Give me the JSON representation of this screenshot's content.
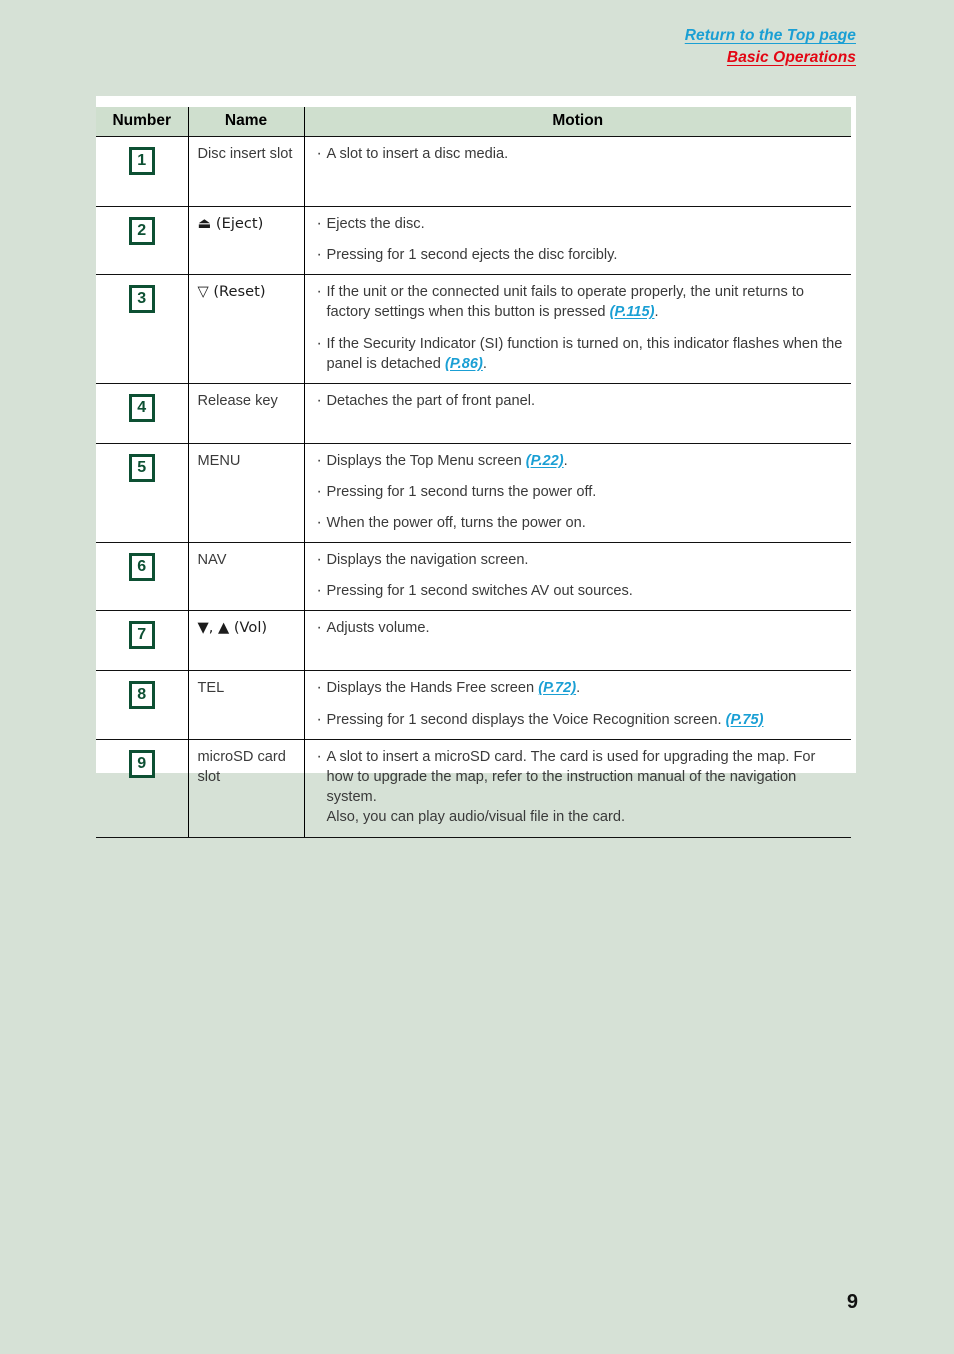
{
  "header": {
    "top_link": "Return to the Top page",
    "section_link": "Basic Operations",
    "top_link_color": "#1a9fd4",
    "section_link_color": "#e30613"
  },
  "table": {
    "columns": [
      "Number",
      "Name",
      "Motion"
    ],
    "rows": [
      {
        "number": "1",
        "name": "Disc insert slot",
        "motion": [
          {
            "text": "A slot to insert a disc media."
          }
        ]
      },
      {
        "number": "2",
        "name": "⏏ (Eject)",
        "name_symbol": "eject-icon",
        "motion": [
          {
            "text": "Ejects the disc."
          },
          {
            "text": "Pressing for 1 second ejects the disc forcibly."
          }
        ]
      },
      {
        "number": "3",
        "name": "▽ (Reset)",
        "name_symbol": "reset-triangle-icon",
        "motion": [
          {
            "text": "If the unit or the connected unit fails to operate properly, the unit returns to factory settings when this button is pressed ",
            "ref": "(P.115)",
            "tail": "."
          },
          {
            "text": "If the Security Indicator (SI) function is turned on, this indicator flashes when the panel is detached ",
            "ref": "(P.86)",
            "tail": "."
          }
        ]
      },
      {
        "number": "4",
        "name": "Release key",
        "motion": [
          {
            "text": "Detaches the part of front panel."
          }
        ]
      },
      {
        "number": "5",
        "name": "MENU",
        "motion": [
          {
            "text": "Displays the Top Menu screen ",
            "ref": "(P.22)",
            "tail": "."
          },
          {
            "text": "Pressing for 1 second turns the power off."
          },
          {
            "text": "When the power off, turns the power on."
          }
        ]
      },
      {
        "number": "6",
        "name": "NAV",
        "motion": [
          {
            "text": "Displays the navigation screen."
          },
          {
            "text": "Pressing for 1 second switches AV out sources."
          }
        ]
      },
      {
        "number": "7",
        "name": "▼, ▲ (Vol)",
        "name_symbol": "volume-down-up-icon",
        "motion": [
          {
            "text": "Adjusts volume."
          }
        ]
      },
      {
        "number": "8",
        "name": "TEL",
        "motion": [
          {
            "text": "Displays the Hands Free screen ",
            "ref": "(P.72)",
            "tail": "."
          },
          {
            "text": "Pressing for 1 second displays the Voice Recognition screen. ",
            "ref": "(P.75)",
            "tail": ""
          }
        ]
      },
      {
        "number": "9",
        "name": "microSD card slot",
        "motion": [
          {
            "text": "A slot to insert a microSD card. The card is used for upgrading the map. For how to upgrade the map, refer to the instruction manual of the navigation system.",
            "sub": "Also, you can play audio/visual file in the card."
          }
        ]
      }
    ]
  },
  "footer": {
    "page_number": "9"
  },
  "colors": {
    "page_background": "#d6e1d6",
    "panel_background": "#ffffff",
    "table_header_background": "#cfdfce",
    "badge_green": "#0d5033",
    "reference_link": "#1a9fd4"
  }
}
